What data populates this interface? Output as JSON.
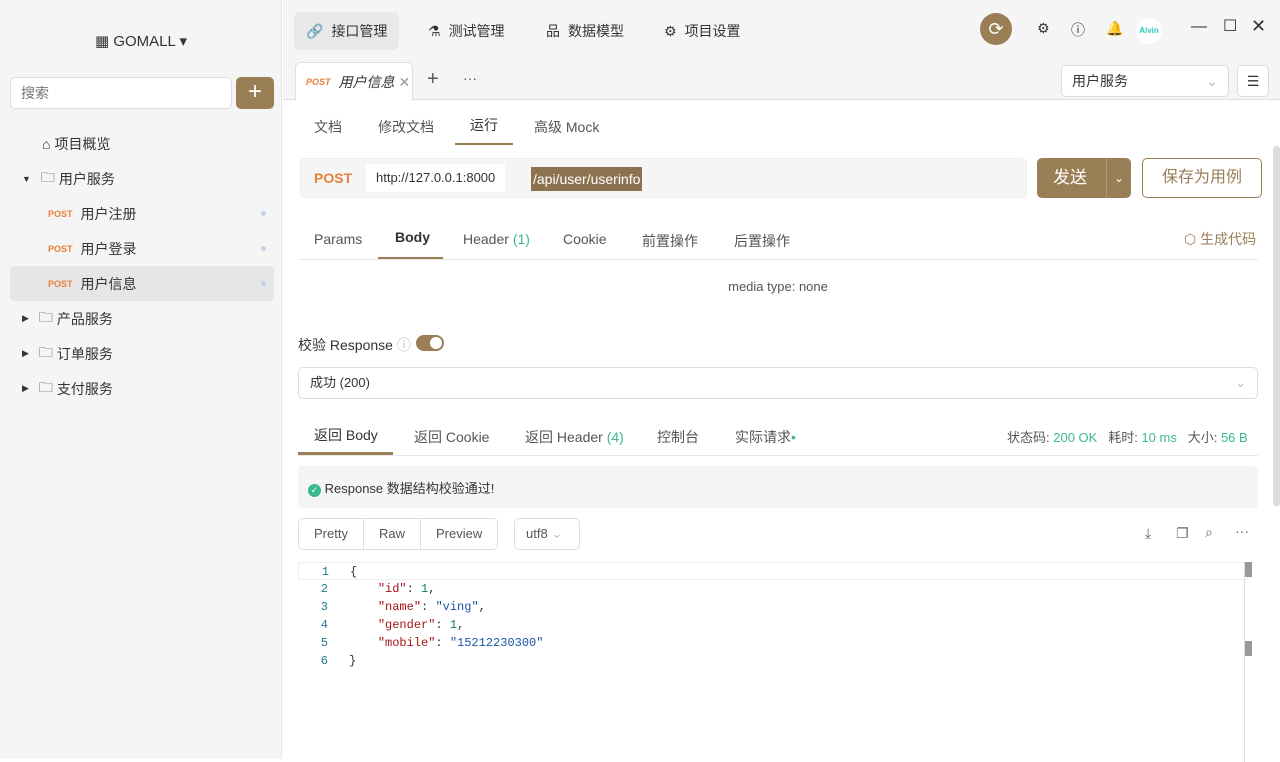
{
  "sidebar": {
    "project": "GOMALL",
    "search_placeholder": "搜索",
    "items": [
      {
        "label": "项目概览"
      },
      {
        "label": "用户服务"
      },
      {
        "method": "POST",
        "label": "用户注册"
      },
      {
        "method": "POST",
        "label": "用户登录"
      },
      {
        "method": "POST",
        "label": "用户信息"
      },
      {
        "label": "产品服务"
      },
      {
        "label": "订单服务"
      },
      {
        "label": "支付服务"
      }
    ]
  },
  "topnav": [
    {
      "label": "接口管理"
    },
    {
      "label": "测试管理"
    },
    {
      "label": "数据模型"
    },
    {
      "label": "项目设置"
    }
  ],
  "avatar_text": "Aivin",
  "file_tab": {
    "method": "POST",
    "label": "用户信息"
  },
  "service_select": "用户服务",
  "subtabs": [
    "文档",
    "修改文档",
    "运行",
    "高级 Mock"
  ],
  "request": {
    "method": "POST",
    "base": "http://127.0.0.1:8000",
    "path": "/api/user/userinfo",
    "send": "发送",
    "save": "保存为用例"
  },
  "req_tabs": [
    "Params",
    "Body",
    "Header",
    "Cookie",
    "前置操作",
    "后置操作"
  ],
  "header_count": "(1)",
  "gen_code": "生成代码",
  "media_type": "media type: none",
  "validate_label": "校验 Response",
  "validate_select": "成功 (200)",
  "resp_tabs": [
    "返回 Body",
    "返回 Cookie",
    "返回 Header",
    "控制台",
    "实际请求"
  ],
  "resp_header_count": "(4)",
  "status": {
    "code_label": "状态码:",
    "code": "200 OK",
    "time_label": "耗时:",
    "time": "10 ms",
    "size_label": "大小:",
    "size": "56 B"
  },
  "validate_msg": "Response 数据结构校验通过!",
  "view_modes": [
    "Pretty",
    "Raw",
    "Preview"
  ],
  "encoding": "utf8",
  "code_lines": [
    [
      "{"
    ],
    [
      "    ",
      "\"id\"",
      ": ",
      "1",
      ","
    ],
    [
      "    ",
      "\"name\"",
      ": ",
      "\"ving\"",
      ","
    ],
    [
      "    ",
      "\"gender\"",
      ": ",
      "1",
      ","
    ],
    [
      "    ",
      "\"mobile\"",
      ": ",
      "\"15212230300\""
    ],
    [
      "}"
    ]
  ],
  "colors": {
    "accent": "#9a7e55",
    "green": "#3cb98e",
    "post": "#e8803a"
  }
}
